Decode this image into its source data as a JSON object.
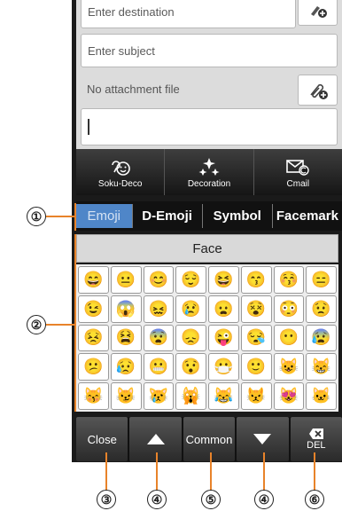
{
  "compose": {
    "destination_placeholder": "Enter destination",
    "subject_placeholder": "Enter subject",
    "attachment_label": "No attachment file"
  },
  "toolbar": [
    {
      "label": "Soku-Deco",
      "icon": "soku-deco-icon"
    },
    {
      "label": "Decoration",
      "icon": "sparkle-icon"
    },
    {
      "label": "Cmail",
      "icon": "cmail-icon"
    }
  ],
  "tabs": [
    {
      "label": "Emoji",
      "active": true
    },
    {
      "label": "D-Emoji",
      "active": false
    },
    {
      "label": "Symbol",
      "active": false
    },
    {
      "label": "Facemark",
      "active": false
    }
  ],
  "category": "Face",
  "emoji_grid": [
    [
      "😄",
      "😐",
      "😊",
      "😌",
      "😆",
      "😙",
      "😚",
      "😑"
    ],
    [
      "😉",
      "😱",
      "😖",
      "😢",
      "😦",
      "😵",
      "😳",
      "😟"
    ],
    [
      "😣",
      "😫",
      "😨",
      "😞",
      "😜",
      "😪",
      "😶",
      "😰"
    ],
    [
      "😕",
      "😥",
      "😬",
      "😯",
      "😷",
      "🙂",
      "😺",
      "😸"
    ],
    [
      "😽",
      "😼",
      "😿",
      "🙀",
      "😹",
      "😾",
      "😻",
      "🐱"
    ]
  ],
  "bottom_bar": {
    "close": "Close",
    "common": "Common",
    "del": "DEL"
  },
  "callouts": [
    "①",
    "②",
    "③",
    "④",
    "⑤",
    "④",
    "⑥"
  ],
  "colors": {
    "accent_tab": "#4f86c8",
    "callout_line": "#e8832a"
  }
}
